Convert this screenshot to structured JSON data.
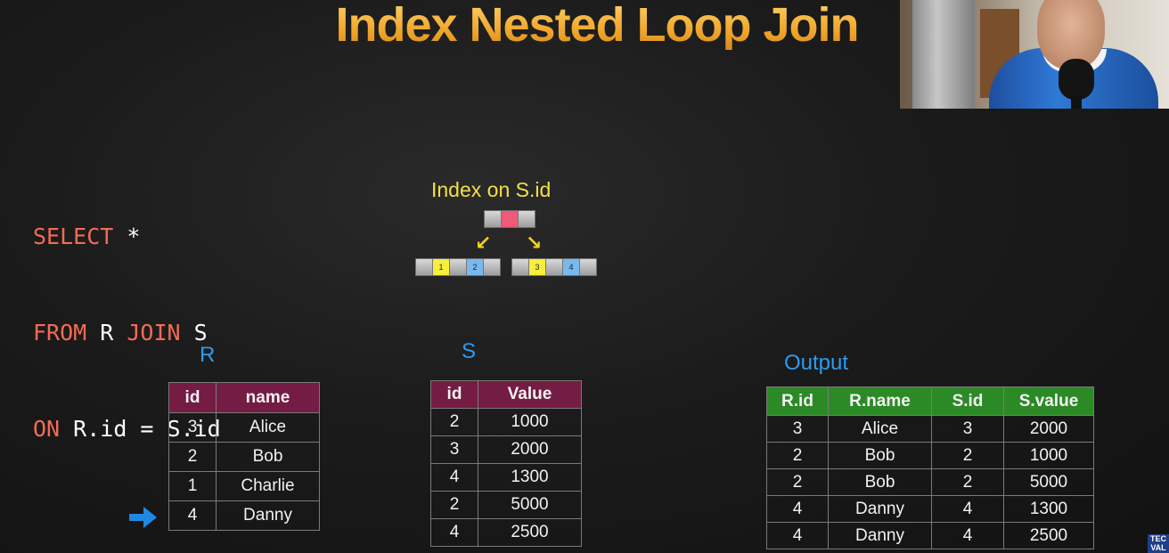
{
  "title": "Index Nested Loop Join",
  "sql": {
    "line1": {
      "kw1": "SELECT",
      "rest": " *"
    },
    "line2": {
      "kw1": "FROM",
      "mid": " R ",
      "kw2": "JOIN",
      "rest": " S"
    },
    "line3": {
      "kw1": "ON",
      "rest": " R.id = S.id"
    }
  },
  "index": {
    "title": "Index on S.id",
    "leaf_left": [
      "",
      "1",
      "",
      "2",
      ""
    ],
    "leaf_right": [
      "",
      "3",
      "",
      "4",
      ""
    ]
  },
  "table_r": {
    "label": "R",
    "headers": [
      "id",
      "name"
    ],
    "rows": [
      [
        "3",
        "Alice"
      ],
      [
        "2",
        "Bob"
      ],
      [
        "1",
        "Charlie"
      ],
      [
        "4",
        "Danny"
      ]
    ]
  },
  "table_s": {
    "label": "S",
    "headers": [
      "id",
      "Value"
    ],
    "rows": [
      [
        "2",
        "1000"
      ],
      [
        "3",
        "2000"
      ],
      [
        "4",
        "1300"
      ],
      [
        "2",
        "5000"
      ],
      [
        "4",
        "2500"
      ]
    ]
  },
  "table_output": {
    "label": "Output",
    "headers": [
      "R.id",
      "R.name",
      "S.id",
      "S.value"
    ],
    "rows": [
      [
        "3",
        "Alice",
        "3",
        "2000"
      ],
      [
        "2",
        "Bob",
        "2",
        "1000"
      ],
      [
        "2",
        "Bob",
        "2",
        "5000"
      ],
      [
        "4",
        "Danny",
        "4",
        "1300"
      ],
      [
        "4",
        "Danny",
        "4",
        "2500"
      ]
    ]
  },
  "colors": {
    "title": "#f0a82c",
    "keyword": "#f36b55",
    "index_title": "#f3e04a",
    "table_label": "#2b9cf2",
    "input_header": "#741c43",
    "output_header": "#2c8a26",
    "pointer": "#1e88e5"
  },
  "icons": {
    "pointer": "arrow-right-icon",
    "index_arrows": "arrow-down-icon"
  },
  "corner_logo": "TEC VAL"
}
